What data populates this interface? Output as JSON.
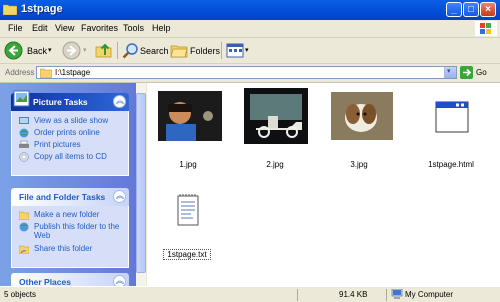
{
  "window": {
    "title": "1stpage"
  },
  "menu": [
    "File",
    "Edit",
    "View",
    "Favorites",
    "Tools",
    "Help"
  ],
  "toolbar": {
    "back": "Back",
    "search": "Search",
    "folders": "Folders"
  },
  "address": {
    "label": "Address",
    "value": "I:\\1stpage",
    "go": "Go"
  },
  "picture_tasks": {
    "title": "Picture Tasks",
    "items": [
      "View as a slide show",
      "Order prints online",
      "Print pictures",
      "Copy all items to CD"
    ]
  },
  "file_folder_tasks": {
    "title": "File and Folder Tasks",
    "items": [
      "Make a new folder",
      "Publish this folder to the Web",
      "Share this folder"
    ]
  },
  "other_places": {
    "title": "Other Places"
  },
  "files": [
    {
      "name": "1.jpg",
      "kind": "photo-boy"
    },
    {
      "name": "2.jpg",
      "kind": "photo-model-car"
    },
    {
      "name": "3.jpg",
      "kind": "photo-dog"
    },
    {
      "name": "1stpage.html",
      "kind": "html-window"
    },
    {
      "name": "1stpage.txt",
      "kind": "text-notepad"
    }
  ],
  "status": {
    "objects": "5 objects",
    "size": "91.4 KB",
    "location": "My Computer"
  },
  "colors": {
    "titlebar": "#0553da",
    "taskpane": "#6f8edb",
    "link": "#215dc6"
  }
}
